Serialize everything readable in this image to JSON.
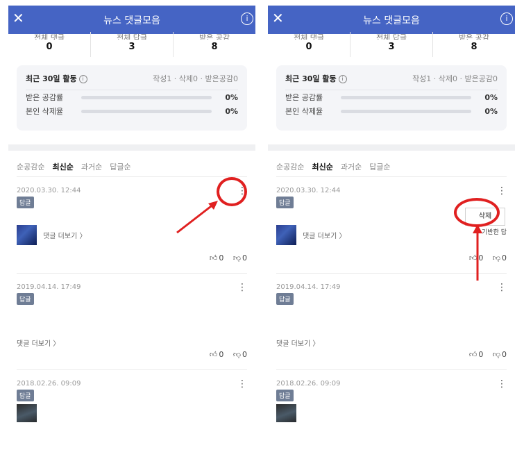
{
  "header": {
    "title": "뉴스 댓글모음",
    "close_icon": "close-icon",
    "info_icon": "info-icon"
  },
  "stats": [
    {
      "label": "전체 댓글",
      "value": "0"
    },
    {
      "label": "전체 답글",
      "value": "3"
    },
    {
      "label": "받은 공감",
      "value": "8"
    }
  ],
  "activity": {
    "title": "최근 30일 활동",
    "summary": "작성1 · 삭제0 · 받은공감0",
    "rates": [
      {
        "label": "받은 공감률",
        "value": "0%"
      },
      {
        "label": "본인 삭제율",
        "value": "0%"
      }
    ]
  },
  "sort_tabs": [
    "순공감순",
    "최신순",
    "과거순",
    "답글순"
  ],
  "sort_active": "최신순",
  "comments": [
    {
      "date": "2020.03.30. 12:44",
      "badge": "답글",
      "more_replies": "댓글 더보기 〉",
      "likes": "0",
      "dislikes": "0"
    },
    {
      "date": "2019.04.14. 17:49",
      "badge": "답글",
      "more_replies": "댓글 더보기 〉",
      "likes": "0",
      "dislikes": "0"
    },
    {
      "date": "2018.02.26. 09:09",
      "badge": "답글"
    }
  ],
  "popup": {
    "delete_label": "삭제",
    "partial_text": "기반한 답"
  },
  "annotation_color": "#e02020",
  "accent_color": "#4564c4"
}
